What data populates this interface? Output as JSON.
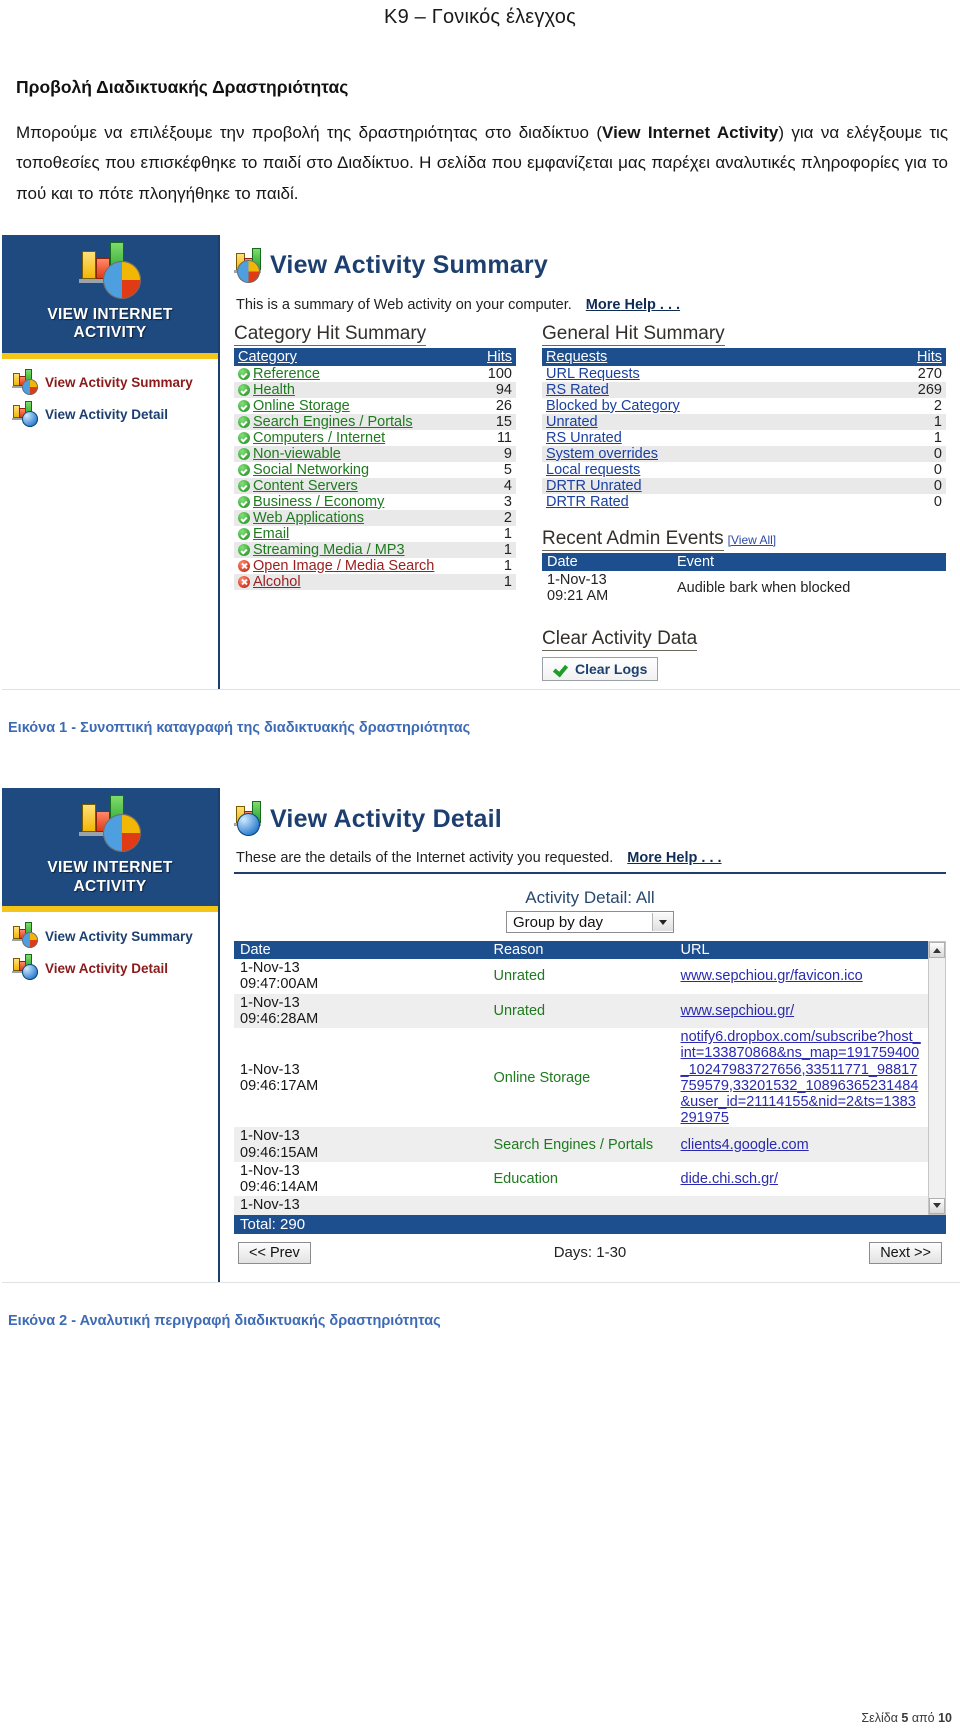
{
  "document": {
    "title": "K9 – Γονικός έλεγχος",
    "section_heading": "Προβολή Διαδικτυακής Δραστηριότητας",
    "paragraph_part1": " Μπορούμε να επιλέξουμε την προβολή της δραστηριότητας στο διαδίκτυο (",
    "paragraph_bold1": "View Internet Activity",
    "paragraph_part2": ") για να ελέγξουμε τις τοποθεσίες που επισκέφθηκε το παιδί στο Διαδίκτυο. Η σελίδα που εμφανίζεται μας παρέχει αναλυτικές πληροφορίες για το πού και το πότε πλοηγήθηκε το παιδί.",
    "caption1": "Εικόνα 1 - Συνοπτική καταγραφή της διαδικτυακής δραστηριότητας",
    "caption2": "Εικόνα 2 - Αναλυτική περιγραφή διαδικτυακής δραστηριότητας",
    "footer_prefix": "Σελίδα ",
    "footer_page": "5",
    "footer_mid": " από ",
    "footer_total": "10"
  },
  "colors": {
    "brand_blue": "#1e4a80",
    "header_blue": "#1d4f8f",
    "accent_yellow": "#f5c518",
    "link_blue": "#2a2ab0",
    "ok_green": "#1f7a1f",
    "blocked_red": "#9a2020",
    "caption_blue": "#3e6bb5"
  },
  "shot1": {
    "nav": {
      "hero_line1": "VIEW INTERNET",
      "hero_line2": "ACTIVITY",
      "items": [
        {
          "label": "View Activity Summary",
          "active": true,
          "icon": "chart-pie-icon"
        },
        {
          "label": "View Activity Detail",
          "active": false,
          "icon": "chart-globe-icon"
        }
      ]
    },
    "page_title": "View Activity Summary",
    "page_subtitle": "This is a summary of Web activity on your computer.",
    "more_help": "More Help . . .",
    "category_summary": {
      "title": "Category Hit Summary",
      "columns": [
        "Category",
        "Hits"
      ],
      "rows": [
        {
          "name": "Reference",
          "hits": "100",
          "status": "allowed"
        },
        {
          "name": "Health",
          "hits": "94",
          "status": "allowed"
        },
        {
          "name": "Online Storage",
          "hits": "26",
          "status": "allowed"
        },
        {
          "name": "Search Engines / Portals",
          "hits": "15",
          "status": "allowed"
        },
        {
          "name": "Computers / Internet",
          "hits": "11",
          "status": "allowed"
        },
        {
          "name": "Non-viewable",
          "hits": "9",
          "status": "allowed"
        },
        {
          "name": "Social Networking",
          "hits": "5",
          "status": "allowed"
        },
        {
          "name": "Content Servers",
          "hits": "4",
          "status": "allowed"
        },
        {
          "name": "Business / Economy",
          "hits": "3",
          "status": "allowed"
        },
        {
          "name": "Web Applications",
          "hits": "2",
          "status": "allowed"
        },
        {
          "name": "Email",
          "hits": "1",
          "status": "allowed"
        },
        {
          "name": "Streaming Media / MP3",
          "hits": "1",
          "status": "allowed"
        },
        {
          "name": "Open Image / Media Search",
          "hits": "1",
          "status": "blocked"
        },
        {
          "name": "Alcohol",
          "hits": "1",
          "status": "blocked"
        }
      ]
    },
    "general_summary": {
      "title": "General Hit Summary",
      "columns": [
        "Requests",
        "Hits"
      ],
      "rows": [
        {
          "name": "URL Requests",
          "hits": "270"
        },
        {
          "name": "RS Rated",
          "hits": "269"
        },
        {
          "name": "Blocked by Category",
          "hits": "2"
        },
        {
          "name": "Unrated",
          "hits": "1"
        },
        {
          "name": "RS Unrated",
          "hits": "1"
        },
        {
          "name": "System overrides",
          "hits": "0"
        },
        {
          "name": "Local requests",
          "hits": "0"
        },
        {
          "name": "DRTR Unrated",
          "hits": "0"
        },
        {
          "name": "DRTR Rated",
          "hits": "0"
        }
      ]
    },
    "recent_admin_events": {
      "title": "Recent Admin Events",
      "view_all": "[View All]",
      "columns": [
        "Date",
        "Event"
      ],
      "rows": [
        {
          "date": "1-Nov-13\n09:21 AM",
          "event": "Audible bark when blocked"
        }
      ]
    },
    "clear_activity": {
      "title": "Clear Activity Data",
      "button_label": "Clear Logs"
    }
  },
  "shot2": {
    "nav": {
      "hero_line1": "VIEW INTERNET",
      "hero_line2": "ACTIVITY",
      "items": [
        {
          "label": "View Activity Summary",
          "active": false,
          "icon": "chart-pie-icon"
        },
        {
          "label": "View Activity Detail",
          "active": true,
          "icon": "chart-globe-icon"
        }
      ]
    },
    "page_title": "View Activity Detail",
    "page_subtitle": "These are the details of the Internet activity you requested.",
    "more_help": "More Help . . .",
    "detail_label": "Activity Detail: All",
    "group_select_value": "Group by day",
    "table": {
      "columns": [
        "Date",
        "Reason",
        "URL"
      ],
      "rows": [
        {
          "date": "1-Nov-13\n09:47:00AM",
          "reason": "Unrated",
          "url": "www.sepchiou.gr/favicon.ico"
        },
        {
          "date": "1-Nov-13\n09:46:28AM",
          "reason": "Unrated",
          "url": "www.sepchiou.gr/"
        },
        {
          "date": "1-Nov-13\n09:46:17AM",
          "reason": "Online Storage",
          "url": "notify6.dropbox.com/subscribe?host_int=133870868&ns_map=191759400_10247983727656,33511771_98817759579,33201532_10896365231484&user_id=21114155&nid=2&ts=1383291975"
        },
        {
          "date": "1-Nov-13\n09:46:15AM",
          "reason": "Search Engines / Portals",
          "url": "clients4.google.com"
        },
        {
          "date": "1-Nov-13\n09:46:14AM",
          "reason": "Education",
          "url": "dide.chi.sch.gr/"
        },
        {
          "date": "1-Nov-13",
          "reason": "",
          "url": ""
        }
      ]
    },
    "total_label": "Total: 290",
    "prev_label": "<< Prev",
    "next_label": "Next >>",
    "days_label": "Days: 1-30"
  }
}
